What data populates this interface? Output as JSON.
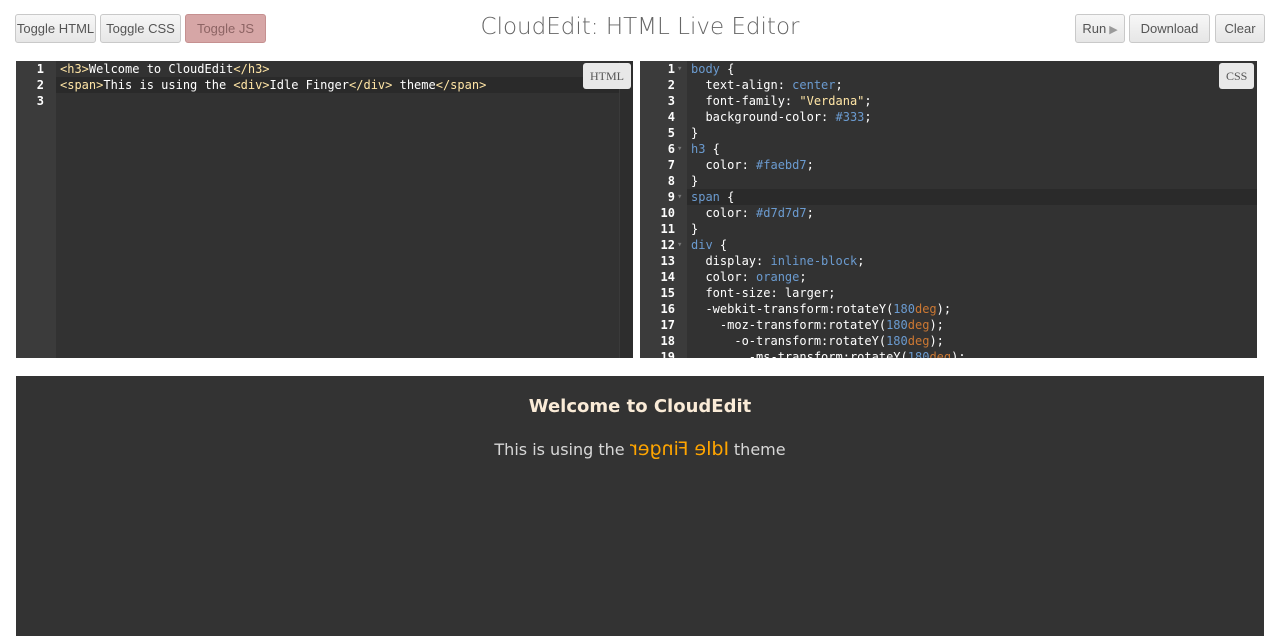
{
  "toolbar": {
    "toggle_html": "Toggle HTML",
    "toggle_css": "Toggle CSS",
    "toggle_js": "Toggle JS",
    "run": "Run",
    "download": "Download",
    "clear": "Clear"
  },
  "title": "CloudEdit: HTML Live Editor",
  "html_editor": {
    "badge": "HTML",
    "line_numbers": [
      "1",
      "2",
      "3"
    ]
  },
  "css_editor": {
    "badge": "CSS",
    "line_numbers": [
      "1",
      "2",
      "3",
      "4",
      "5",
      "6",
      "7",
      "8",
      "9",
      "10",
      "11",
      "12",
      "13",
      "14",
      "15",
      "16",
      "17",
      "18",
      "19"
    ]
  },
  "preview": {
    "heading": "Welcome to CloudEdit",
    "text_before": "This is using the ",
    "flipped_text": "Idle Finger",
    "text_after": " theme"
  },
  "colors": {
    "editor_bg": "#323232",
    "preview_bg": "#333333",
    "heading_color": "#faebd7",
    "span_color": "#d7d7d7",
    "div_color": "orange",
    "active_button": "#d6a6a6"
  },
  "icons": {
    "run": "play-icon",
    "fold": "fold-arrow-icon"
  }
}
